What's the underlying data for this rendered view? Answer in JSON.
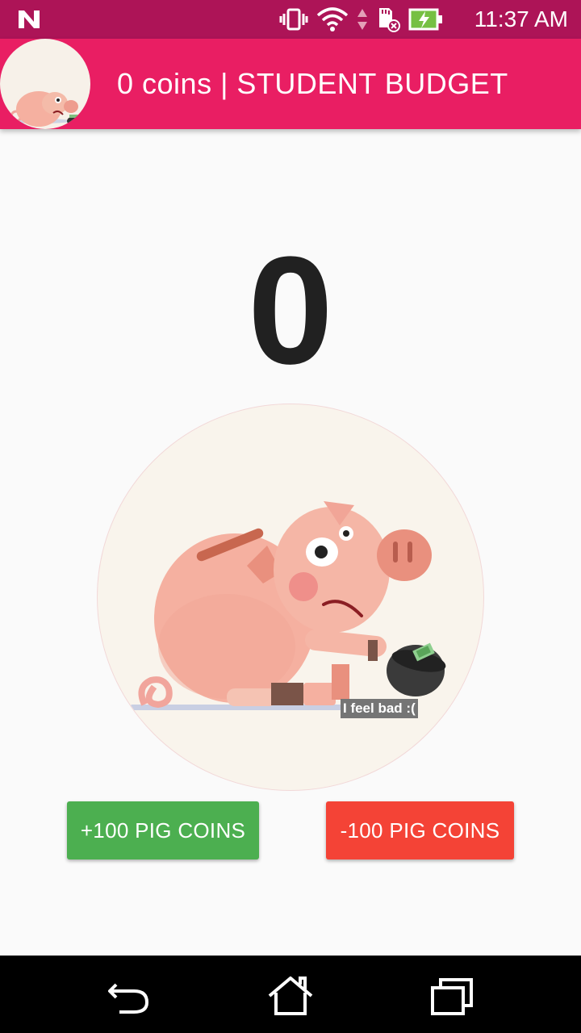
{
  "status_bar": {
    "time": "11:37 AM",
    "icons": [
      "n-logo-icon",
      "vibrate-icon",
      "wifi-icon",
      "data-arrows-icon",
      "sd-card-icon",
      "battery-charging-icon"
    ]
  },
  "app_bar": {
    "title": "0 coins | STUDENT BUDGET",
    "avatar_icon": "piggy-avatar-icon"
  },
  "main": {
    "coin_count": "0",
    "mood_caption": "I feel bad :(",
    "add_button_label": "+100 PIG COINS",
    "subtract_button_label": "-100 PIG COINS"
  },
  "nav_bar": {
    "icons": [
      "back-icon",
      "home-icon",
      "recents-icon"
    ]
  },
  "colors": {
    "status_bar": "#ad1457",
    "app_bar": "#e91e63",
    "add_button": "#4caf50",
    "subtract_button": "#f44336",
    "battery": "#76c043"
  }
}
